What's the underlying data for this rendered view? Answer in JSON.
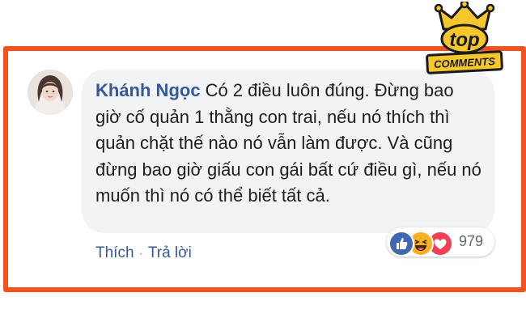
{
  "badge": {
    "top_label": "top",
    "bottom_label": "COMMENTS"
  },
  "comment": {
    "author": "Khánh Ngọc",
    "text": "Có 2 điều luôn đúng. Đừng bao giờ cố quản 1 thằng con trai, nếu nó thích thì quản chặt thế nào nó vẫn làm được. Và cũng đừng bao giờ giấu con gái bất cứ điều gì, nếu nó muốn thì nó có thể biết tất cả.",
    "reactions": [
      "like-icon",
      "haha-icon",
      "love-icon"
    ],
    "reaction_count": "979"
  },
  "actions": {
    "like_label": "Thích",
    "separator": "·",
    "reply_label": "Trả lời"
  },
  "colors": {
    "frame": "#f4511e",
    "author": "#365899",
    "bubble": "#f2f3f5",
    "like": "#4267b2",
    "haha": "#f7b125",
    "love": "#f33e58"
  }
}
